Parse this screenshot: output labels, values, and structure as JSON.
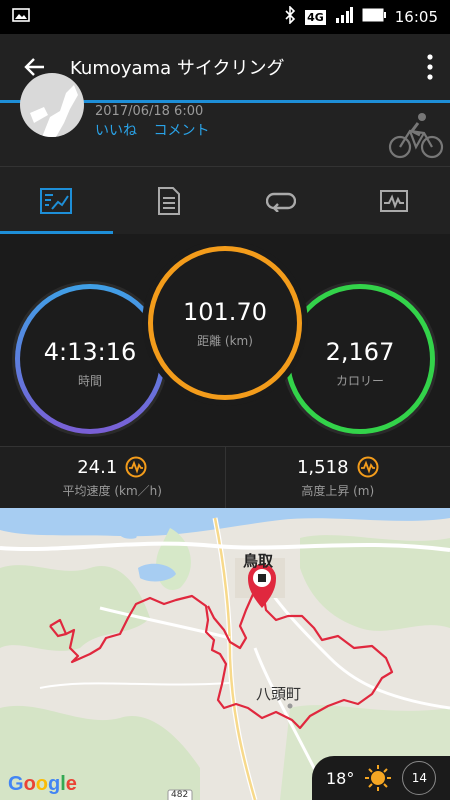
{
  "status": {
    "time": "16:05",
    "network": "4G"
  },
  "appbar": {
    "title": "Kumoyama サイクリング"
  },
  "header": {
    "date": "2017/06/18 6:00",
    "like": "いいね",
    "comment": "コメント"
  },
  "stats": {
    "time": {
      "value": "4:13:16",
      "label": "時間"
    },
    "distance": {
      "value": "101.70",
      "label": "距離 (km)"
    },
    "calories": {
      "value": "2,167",
      "label": "カロリー"
    }
  },
  "metrics": {
    "avg_speed": {
      "value": "24.1",
      "label": "平均速度 (km／h)"
    },
    "elevation": {
      "value": "1,518",
      "label": "高度上昇 (m)"
    }
  },
  "map": {
    "city1": "鳥取",
    "city2": "八頭町",
    "road": "482",
    "google": "Google"
  },
  "weather": {
    "temp": "18°",
    "wind": "14"
  },
  "colors": {
    "accent": "#1e8fd8",
    "route": "#e0283e",
    "orange": "#f39c1b",
    "green": "#33d34a",
    "purple": "#7a5fd6"
  }
}
